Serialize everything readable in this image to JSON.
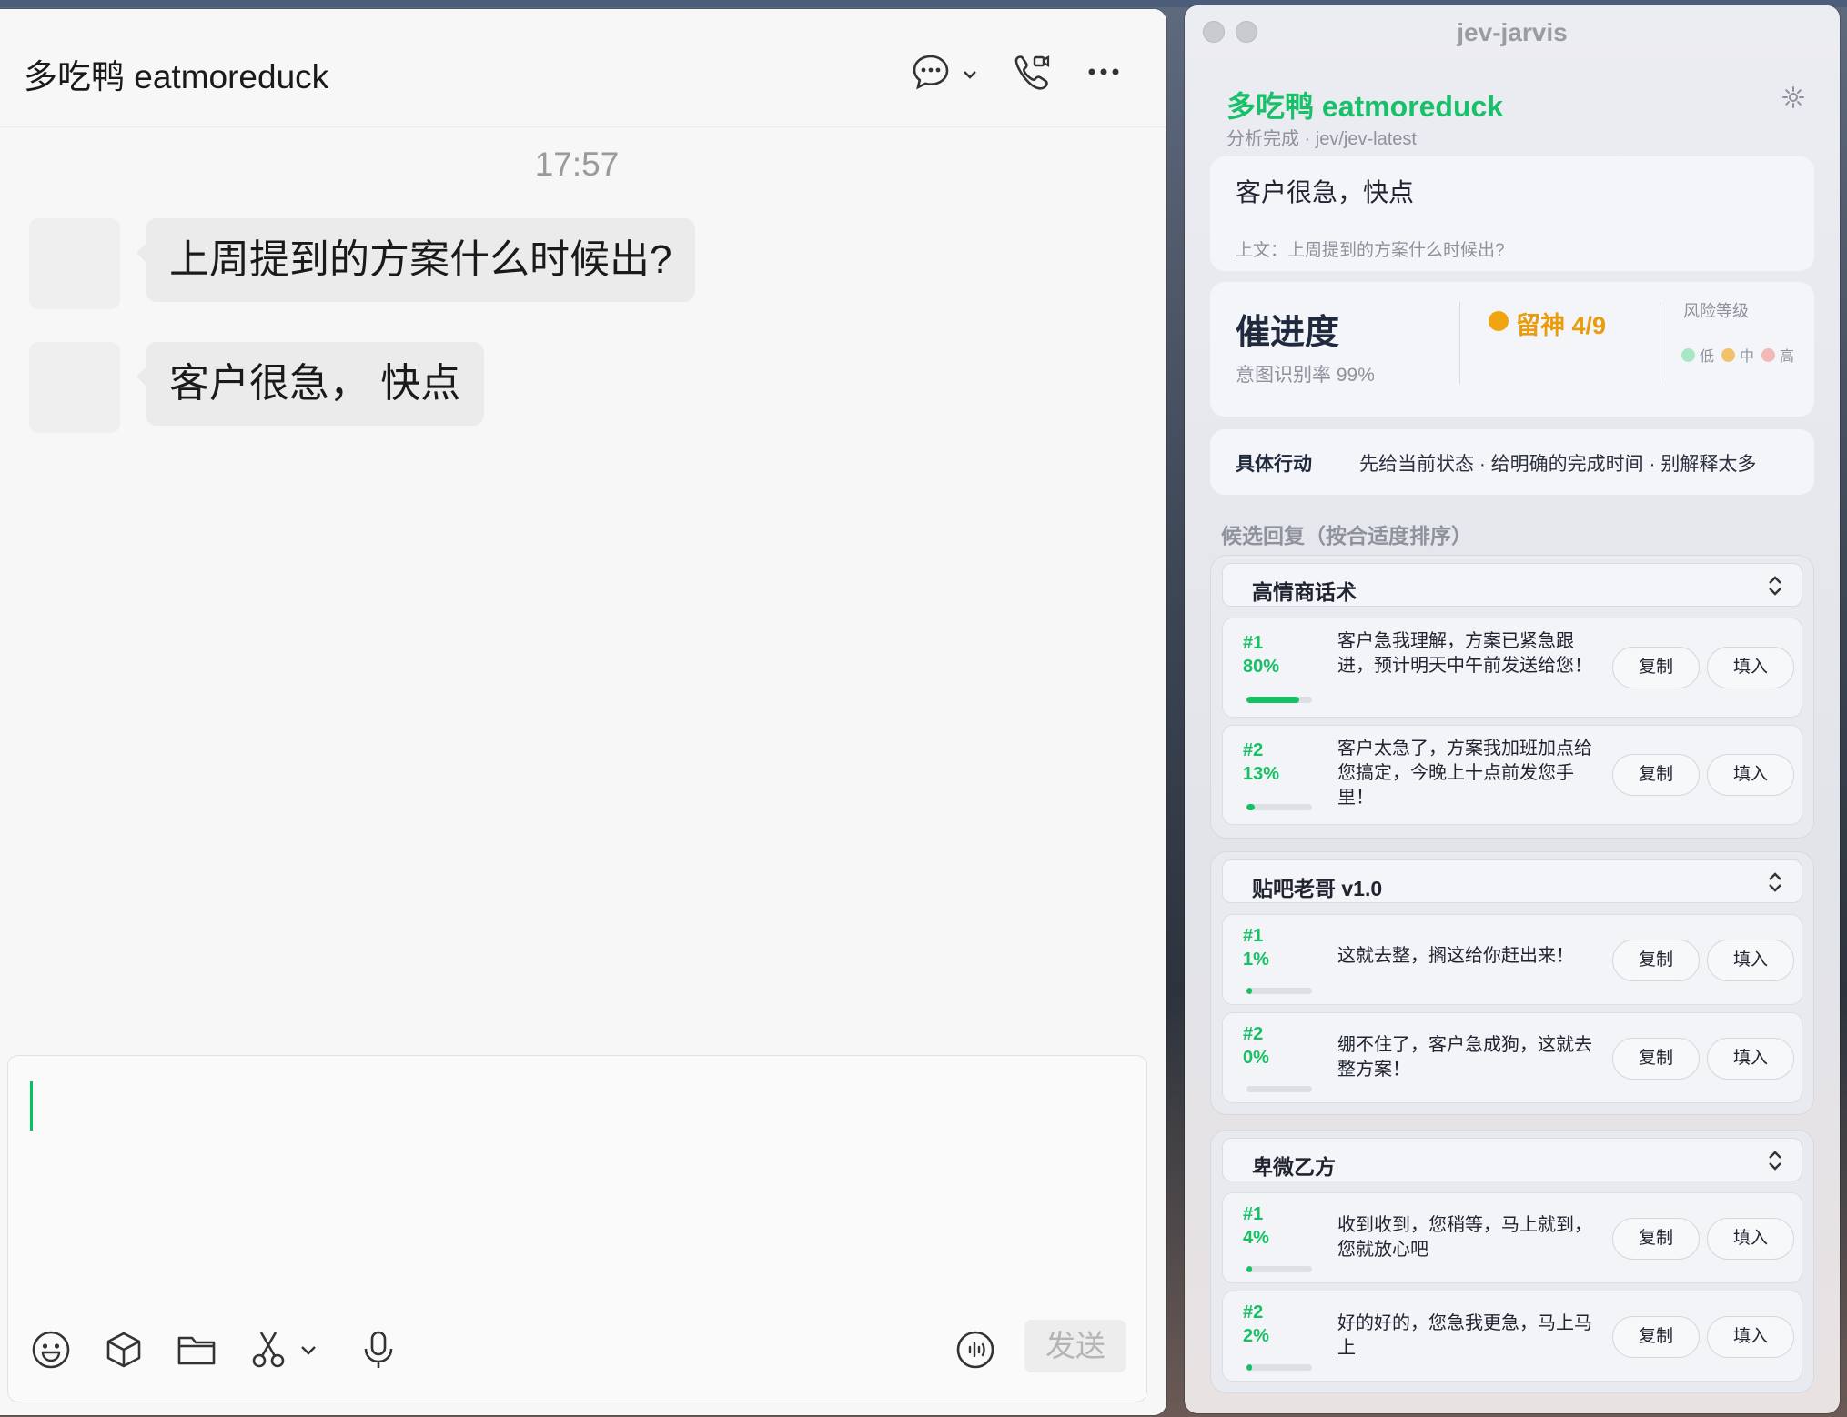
{
  "chat": {
    "title": "多吃鸭 eatmoreduck",
    "timestamp": "17:57",
    "messages": [
      {
        "text": "上周提到的方案什么时候出?"
      },
      {
        "text": "客户很急，  快点"
      }
    ],
    "input": {
      "value": ""
    },
    "send_label": "发送",
    "icons": [
      "chat-bubble-icon",
      "chevron-down-icon",
      "video-call-icon",
      "more-icon",
      "emoji-icon",
      "cube-icon",
      "folder-icon",
      "scissors-icon",
      "microphone-icon",
      "voice-input-icon"
    ]
  },
  "jarvis": {
    "window_title": "jev-jarvis",
    "contact_name": "多吃鸭 eatmoreduck",
    "status": "分析完成 · jev/jev-latest",
    "message_card": {
      "current": "客户很急，快点",
      "context": "上文：上周提到的方案什么时候出?"
    },
    "intent": {
      "title": "催进度",
      "rate": "意图识别率 99%",
      "warning": "留神  4/9",
      "risk_label": "风险等级",
      "risk_levels": [
        {
          "label": "低",
          "color": "#a8e6c6"
        },
        {
          "label": "中",
          "color": "#f2c26a"
        },
        {
          "label": "高",
          "color": "#f3b8b8"
        }
      ]
    },
    "action": {
      "label": "具体行动",
      "text": "先给当前状态 · 给明确的完成时间 · 别解释太多"
    },
    "candidates_heading": "候选回复（按合适度排序）",
    "copy_label": "复制",
    "fill_label": "填入",
    "groups": [
      {
        "name": "高情商话术",
        "replies": [
          {
            "rank": "#1",
            "pct": "80%",
            "score": 0.8,
            "text": "客户急我理解，方案已紧急跟进，预计明天中午前发送给您！"
          },
          {
            "rank": "#2",
            "pct": "13%",
            "score": 0.13,
            "text": "客户太急了，方案我加班加点给您搞定，今晚上十点前发您手里！"
          }
        ]
      },
      {
        "name": "贴吧老哥 v1.0",
        "replies": [
          {
            "rank": "#1",
            "pct": "1%",
            "score": 0.01,
            "text": "这就去整，搁这给你赶出来！"
          },
          {
            "rank": "#2",
            "pct": "0%",
            "score": 0.0,
            "text": "绷不住了，客户急成狗，这就去整方案！"
          }
        ]
      },
      {
        "name": "卑微乙方",
        "replies": [
          {
            "rank": "#1",
            "pct": "4%",
            "score": 0.04,
            "text": "收到收到，您稍等，马上就到，您就放心吧"
          },
          {
            "rank": "#2",
            "pct": "2%",
            "score": 0.02,
            "text": "好的好的，您急我更急，马上马上"
          }
        ]
      }
    ],
    "colors": {
      "accent": "#16c065",
      "warning": "#f0a410",
      "title": "#1f2a3e"
    }
  }
}
